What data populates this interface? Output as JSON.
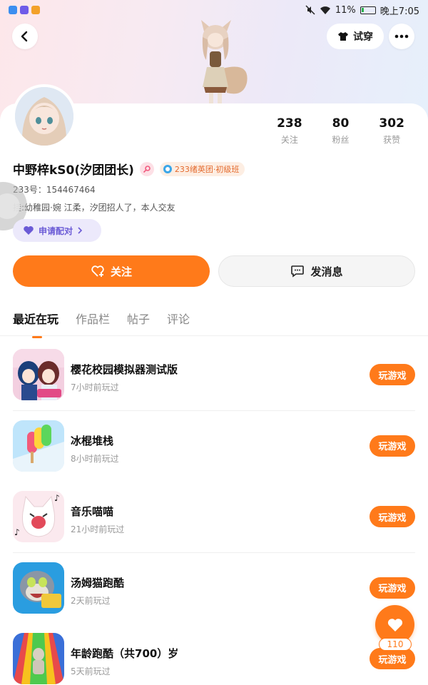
{
  "status_bar": {
    "battery": "11%",
    "time": "晚上7:05"
  },
  "header": {
    "tryon_label": "试穿"
  },
  "profile": {
    "stats": [
      {
        "value": "238",
        "label": "关注"
      },
      {
        "value": "80",
        "label": "粉丝"
      },
      {
        "value": "302",
        "label": "获赞"
      }
    ],
    "name": "中野梓kS0(汐团团长)",
    "level_badge": "233绪英团·初级班",
    "id_line": "233号：154467464",
    "signature": "挂:幼稚园·婉  江柔，汐团招人了，本人交友",
    "match_label": "申请配对",
    "follow_label": "关注",
    "message_label": "发消息"
  },
  "tabs": [
    {
      "label": "最近在玩",
      "active": true
    },
    {
      "label": "作品栏",
      "active": false
    },
    {
      "label": "帖子",
      "active": false
    },
    {
      "label": "评论",
      "active": false
    }
  ],
  "games": [
    {
      "title": "樱花校园模拟器测试版",
      "subtitle": "7小时前玩过",
      "action": "玩游戏",
      "icon": "sakura-school-icon"
    },
    {
      "title": "冰棍堆栈",
      "subtitle": "8小时前玩过",
      "action": "玩游戏",
      "icon": "popsicle-stack-icon"
    },
    {
      "title": "音乐喵喵",
      "subtitle": "21小时前玩过",
      "action": "玩游戏",
      "icon": "music-cat-icon"
    },
    {
      "title": "汤姆猫跑酷",
      "subtitle": "2天前玩过",
      "action": "玩游戏",
      "icon": "tom-run-icon"
    },
    {
      "title": "年龄跑酷（共700）岁",
      "subtitle": "5天前玩过",
      "action": "玩游戏",
      "icon": "age-run-icon"
    }
  ],
  "fab": {
    "like_count": "110"
  },
  "colors": {
    "accent": "#ff7a1a",
    "match_purple": "#6b5bd6"
  }
}
